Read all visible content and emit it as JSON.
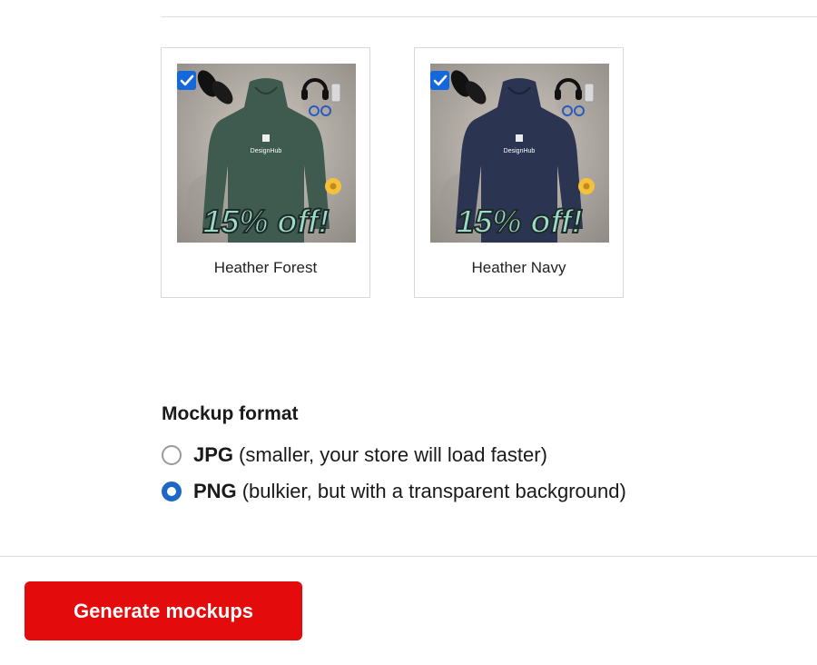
{
  "variants": [
    {
      "label": "Heather Forest",
      "checked": true,
      "brand_text": "DesignHub",
      "promo_text": "15% off!",
      "hoodie_color": "#3f5a4e"
    },
    {
      "label": "Heather Navy",
      "checked": true,
      "brand_text": "DesignHub",
      "promo_text": "15% off!",
      "hoodie_color": "#2b3552"
    }
  ],
  "mockup_format": {
    "heading": "Mockup format",
    "options": [
      {
        "name": "JPG",
        "description": "(smaller, your store will load faster)",
        "selected": false
      },
      {
        "name": "PNG",
        "description": "(bulkier, but with a transparent background)",
        "selected": true
      }
    ]
  },
  "generate_button": {
    "label": "Generate mockups"
  },
  "colors": {
    "accent_red": "#e30b0b",
    "checkbox_blue": "#1468dc",
    "radio_blue": "#1f67c4"
  }
}
